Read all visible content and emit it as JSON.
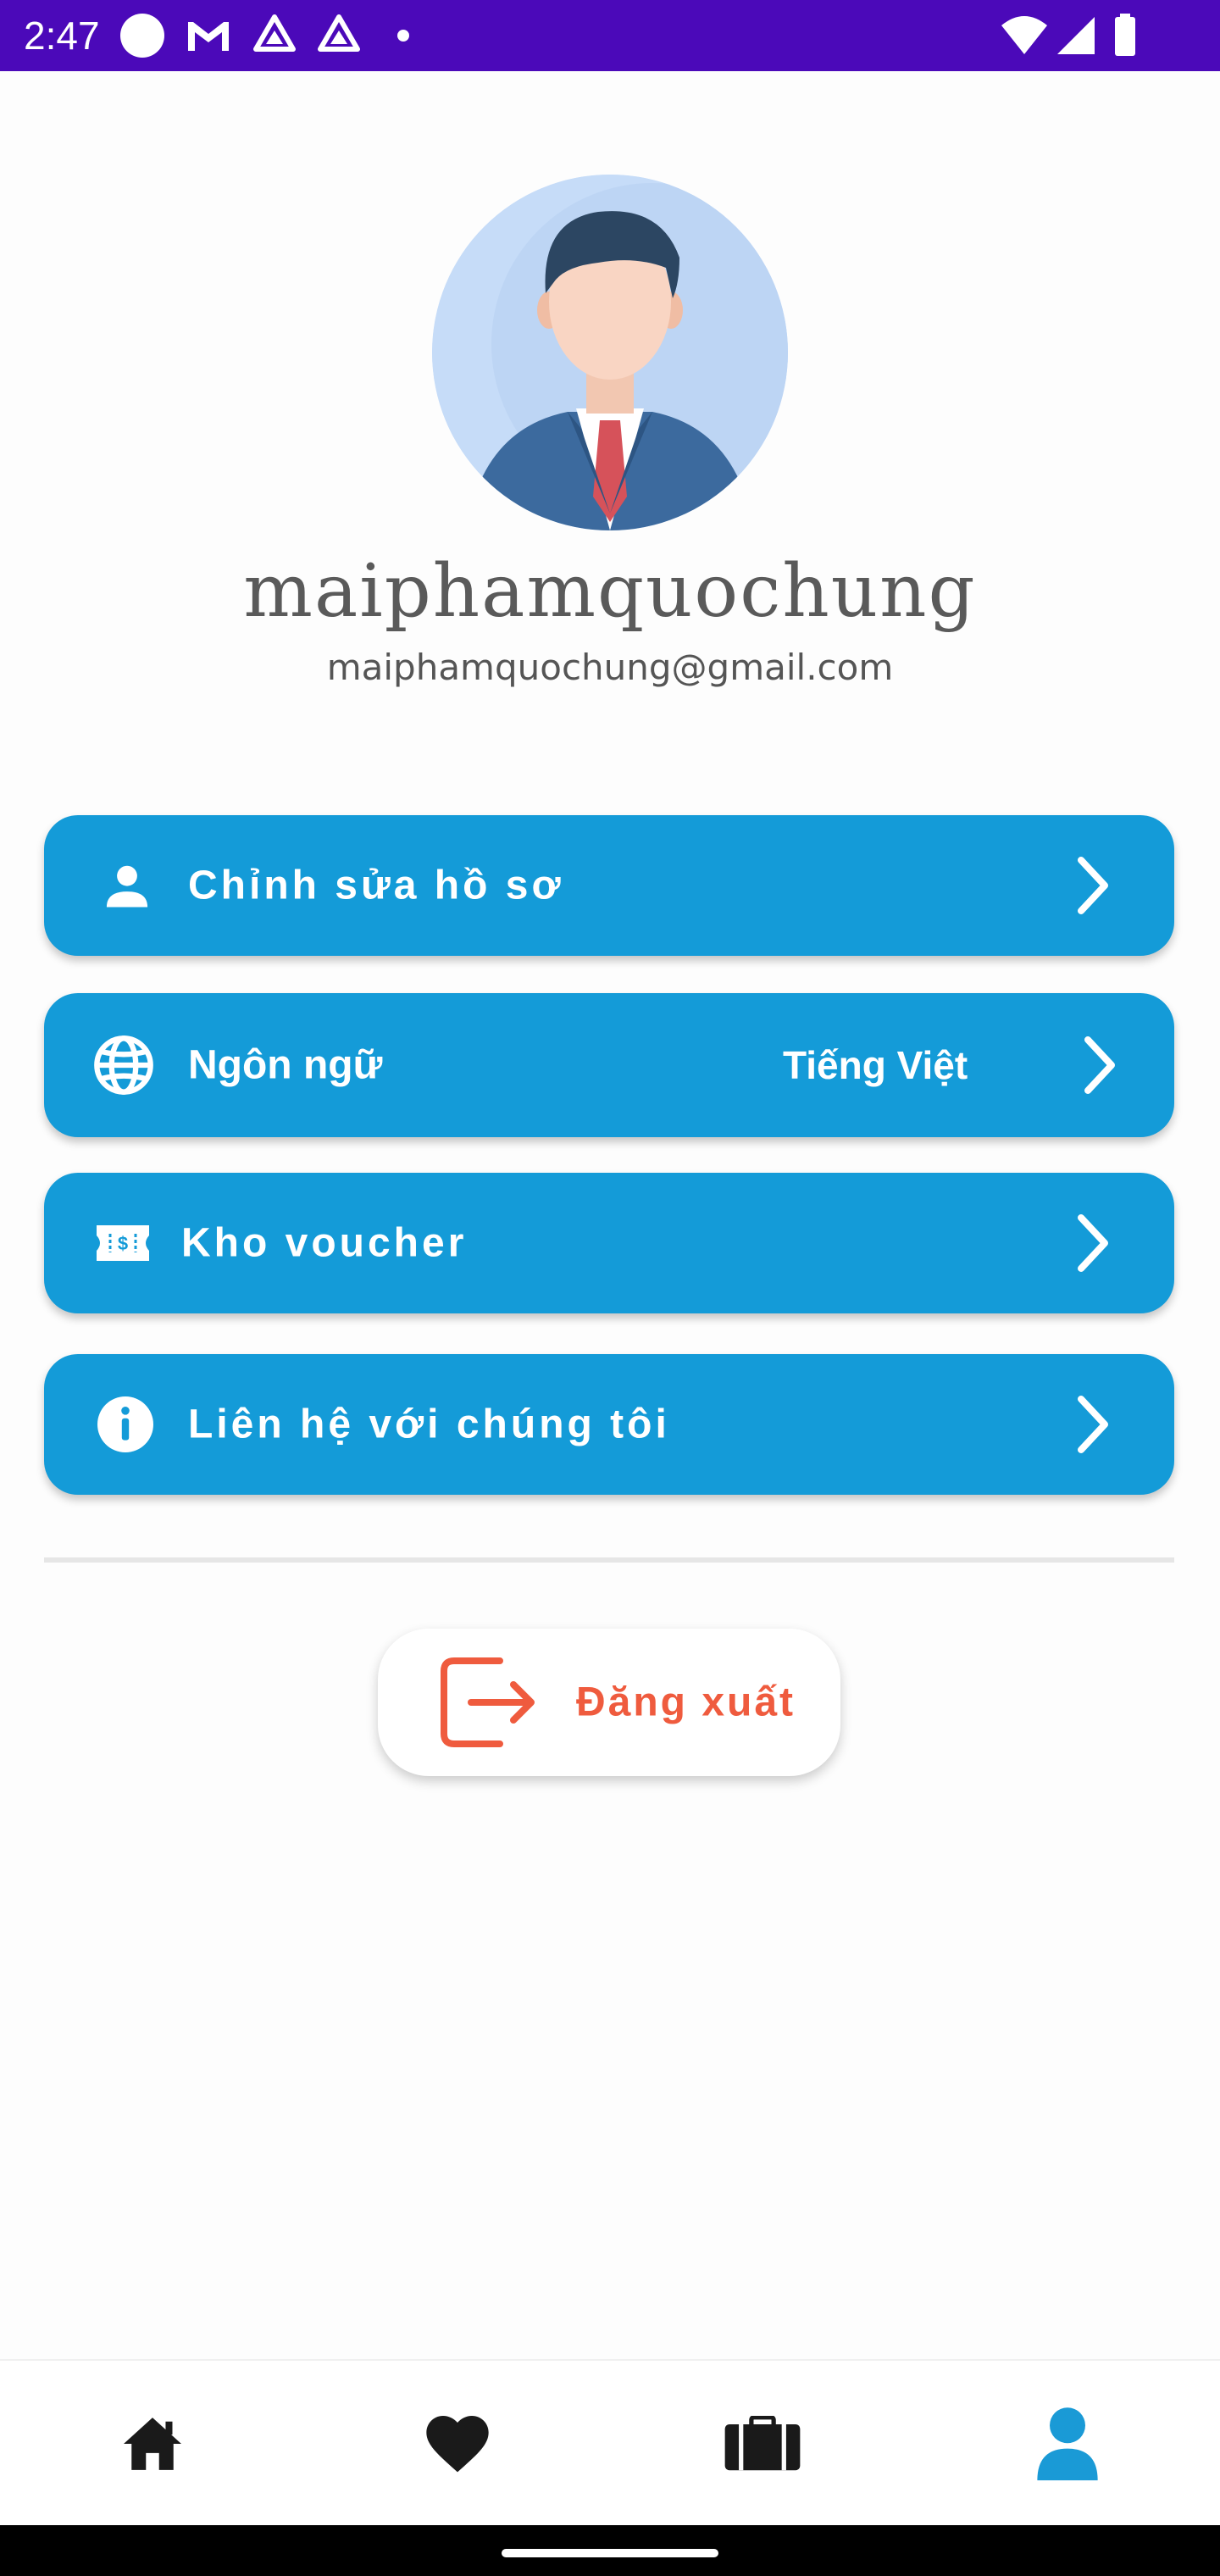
{
  "status_bar": {
    "time": "2:47",
    "icons": [
      "circle-icon",
      "gmail-icon",
      "drive-icon",
      "drive-icon",
      "dot-icon",
      "wifi-icon",
      "signal-icon",
      "battery-icon"
    ]
  },
  "profile": {
    "name": "maiphamquochung",
    "email": "maiphamquochung@gmail.com",
    "avatar_icon": "businessman-avatar"
  },
  "menu": {
    "edit_profile": {
      "label": "Chỉnh sửa hồ sơ",
      "icon": "person-icon"
    },
    "language": {
      "label": "Ngôn ngữ",
      "value": "Tiếng Việt",
      "icon": "globe-icon"
    },
    "vouchers": {
      "label": "Kho voucher",
      "icon": "voucher-icon"
    },
    "contact": {
      "label": "Liên hệ với chúng tôi",
      "icon": "info-icon"
    }
  },
  "logout": {
    "label": "Đăng xuất",
    "icon": "logout-icon"
  },
  "bottom_nav": {
    "items": [
      {
        "icon": "home-icon",
        "active": false
      },
      {
        "icon": "heart-icon",
        "active": false
      },
      {
        "icon": "briefcase-icon",
        "active": false
      },
      {
        "icon": "profile-icon",
        "active": true
      }
    ]
  },
  "colors": {
    "status_bar": "#4b09b9",
    "menu_button": "#149bd8",
    "logout_accent": "#ef5b3e",
    "nav_active": "#1a9ad6",
    "nav_inactive": "#1a1a1a"
  }
}
